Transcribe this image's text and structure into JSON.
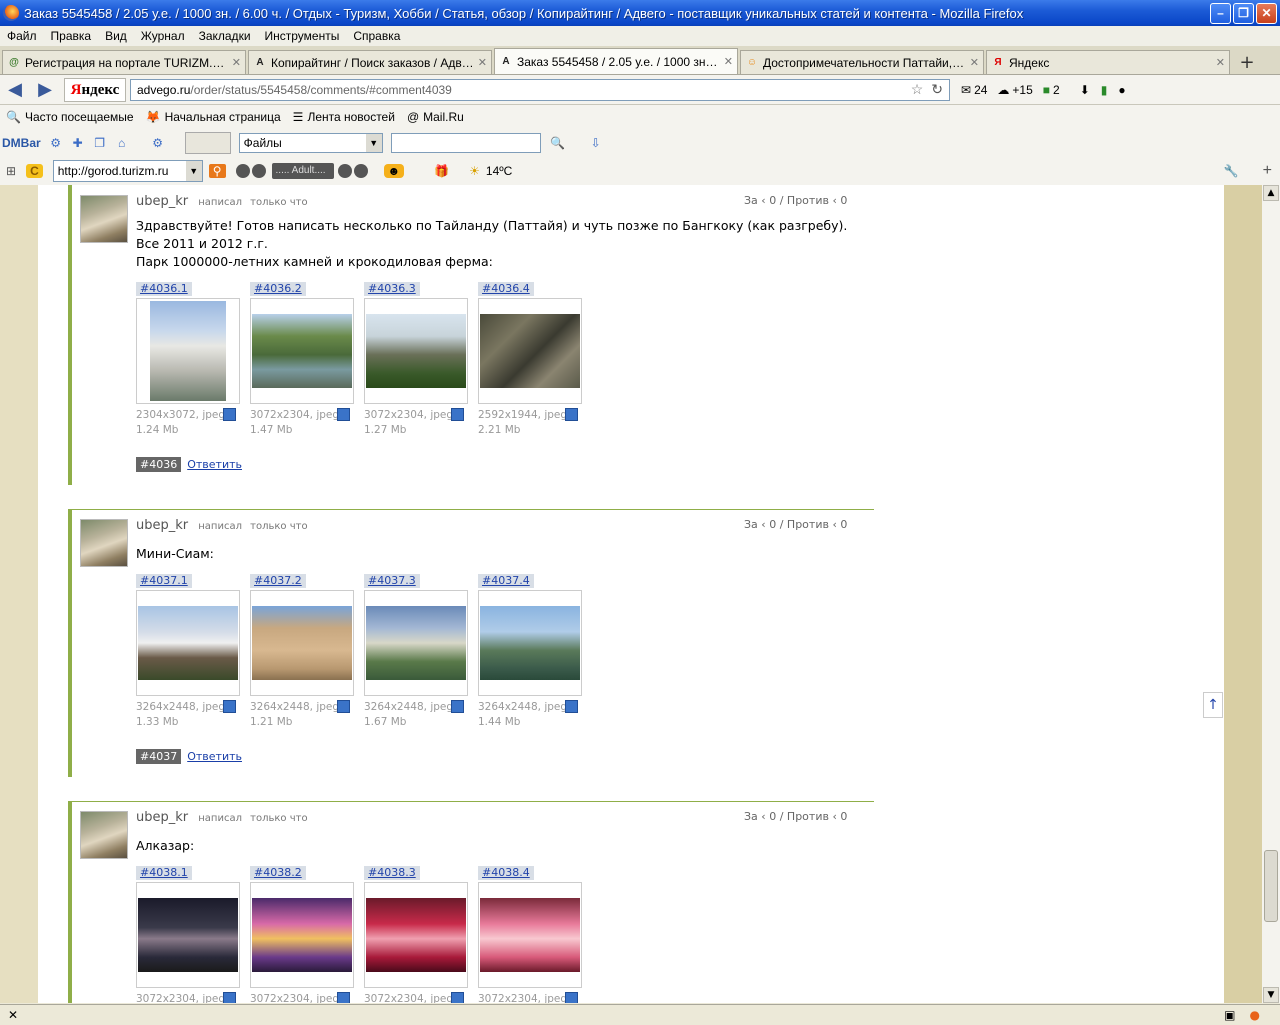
{
  "window": {
    "title": "Заказ 5545458 / 2.05 у.е. / 1000 зн. / 6.00 ч. / Отдых - Туризм, Хобби / Статья, обзор / Копирайтинг / Адвего - поставщик уникальных статей и контента - Mozilla Firefox",
    "minimize": "–",
    "maximize": "❐",
    "close": "✕"
  },
  "menu": [
    "Файл",
    "Правка",
    "Вид",
    "Журнал",
    "Закладки",
    "Инструменты",
    "Справка"
  ],
  "tabs": [
    {
      "label": "Регистрация на портале TURIZM.RU - ...",
      "fav": "@",
      "fav_color": "#3a7a2a"
    },
    {
      "label": "Копирайтинг / Поиск заказов / Адвег...",
      "fav": "A",
      "fav_color": "#222222"
    },
    {
      "label": "Заказ 5545458 / 2.05 у.е. / 1000 зн. / ...",
      "fav": "A",
      "fav_color": "#222222"
    },
    {
      "label": "Достопримечательности Паттайи, Та...",
      "fav": "☺",
      "fav_color": "#e88a1a"
    },
    {
      "label": "Яндекс",
      "fav": "Я",
      "fav_color": "#dd0000"
    }
  ],
  "tab_close": "✕",
  "tab_new": "+",
  "nav": {
    "back": "◀",
    "forward": "▶",
    "yandex_y": "Я",
    "yandex_rest": "ндекс",
    "url_host": "advego.ru",
    "url_path": "/order/status/5545458/comments/#comment4039",
    "mail_count": "24",
    "weather_delta": "+15",
    "karma_count": "2",
    "star": "☆",
    "reload": "↻"
  },
  "bookmarks": [
    {
      "label": "Часто посещаемые",
      "icon": "🔍"
    },
    {
      "label": "Начальная страница",
      "icon": "🦊"
    },
    {
      "label": "Лента новостей",
      "icon": "☰"
    },
    {
      "label": "Mail.Ru",
      "icon": "@"
    }
  ],
  "dmbar": {
    "logo": "DMBar",
    "files_label": "Файлы",
    "search_placeholder": ""
  },
  "gorodbar": {
    "city_url": "http://gorod.turizm.ru",
    "station": "..... Adult....",
    "temperature": "14ºC"
  },
  "comments": [
    {
      "author": "ubep_kr",
      "wrote": "написал",
      "when": "только что",
      "vote_for": "За",
      "vote_for_count": "0",
      "vote_sep": "/",
      "vote_against": "Против",
      "vote_against_count": "0",
      "text": "Здравствуйте! Готов написать несколько по Тайланду (Паттайя) и чуть позже по Бангкоку (как разгребу). Все 2011 и 2012 г.г.",
      "text2": "Парк 1000000-летних камней и крокодиловая ферма:",
      "id": "#4036",
      "reply": "Ответить",
      "images": [
        {
          "tag": "#4036.1",
          "dims": "2304x3072, jpeg",
          "size": "1.24 Mb"
        },
        {
          "tag": "#4036.2",
          "dims": "3072x2304, jpeg",
          "size": "1.47 Mb"
        },
        {
          "tag": "#4036.3",
          "dims": "3072x2304, jpeg",
          "size": "1.27 Mb"
        },
        {
          "tag": "#4036.4",
          "dims": "2592x1944, jpeg",
          "size": "2.21 Mb"
        }
      ]
    },
    {
      "author": "ubep_kr",
      "wrote": "написал",
      "when": "только что",
      "vote_for": "За",
      "vote_for_count": "0",
      "vote_sep": "/",
      "vote_against": "Против",
      "vote_against_count": "0",
      "text": "Мини-Сиам:",
      "text2": "",
      "id": "#4037",
      "reply": "Ответить",
      "images": [
        {
          "tag": "#4037.1",
          "dims": "3264x2448, jpeg",
          "size": "1.33 Mb"
        },
        {
          "tag": "#4037.2",
          "dims": "3264x2448, jpeg",
          "size": "1.21 Mb"
        },
        {
          "tag": "#4037.3",
          "dims": "3264x2448, jpeg",
          "size": "1.67 Mb"
        },
        {
          "tag": "#4037.4",
          "dims": "3264x2448, jpeg",
          "size": "1.44 Mb"
        }
      ]
    },
    {
      "author": "ubep_kr",
      "wrote": "написал",
      "when": "только что",
      "vote_for": "За",
      "vote_for_count": "0",
      "vote_sep": "/",
      "vote_against": "Против",
      "vote_against_count": "0",
      "text": "Алказар:",
      "text2": "",
      "id": "",
      "reply": "",
      "images": [
        {
          "tag": "#4038.1",
          "dims": "3072x2304, jpeg",
          "size": ""
        },
        {
          "tag": "#4038.2",
          "dims": "3072x2304, jpeg",
          "size": ""
        },
        {
          "tag": "#4038.3",
          "dims": "3072x2304, jpeg",
          "size": ""
        },
        {
          "tag": "#4038.4",
          "dims": "3072x2304, jpeg",
          "size": ""
        }
      ]
    }
  ],
  "scroll_up": "↑",
  "status": {
    "close": "✕"
  }
}
